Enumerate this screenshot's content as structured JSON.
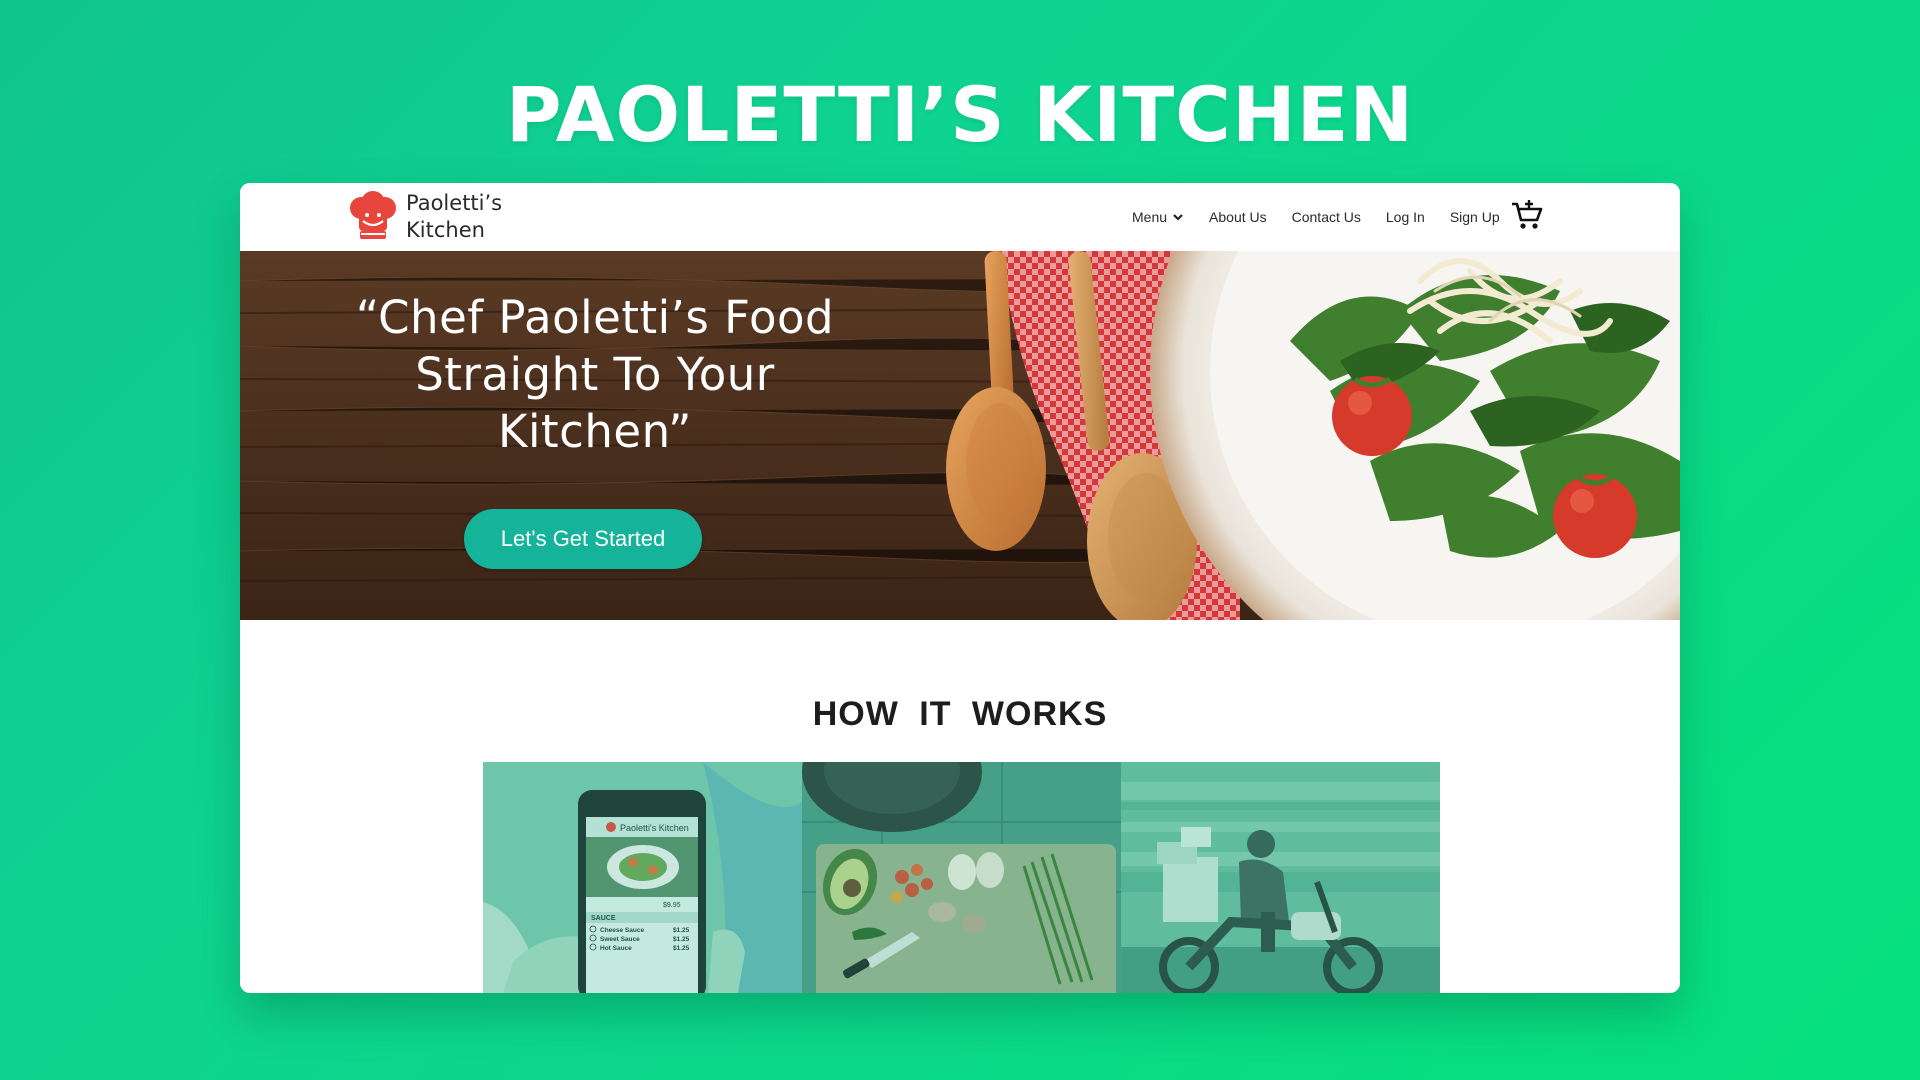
{
  "page": {
    "title": "PAOLETTI’S KITCHEN"
  },
  "header": {
    "brand_line1": "Paoletti’s",
    "brand_line2": "Kitchen",
    "nav": [
      {
        "label": "Menu",
        "has_dropdown": true
      },
      {
        "label": "About Us"
      },
      {
        "label": "Contact Us"
      },
      {
        "label": "Log In"
      },
      {
        "label": "Sign Up"
      }
    ],
    "cart_icon": "cart-plus-icon",
    "logo_icon": "chef-hat-icon"
  },
  "hero": {
    "headline": "“Chef Paoletti’s Food Straight To Your Kitchen”",
    "cta_label": "Let's Get Started"
  },
  "how_it_works": {
    "title": "HOW IT WORKS",
    "phone": {
      "app_name": "Paoletti's Kitchen",
      "price": "$9.95",
      "section": "SAUCE",
      "options": [
        {
          "name": "Cheese Sauce",
          "price": "$1.25"
        },
        {
          "name": "Sweet Sauce",
          "price": "$1.25"
        },
        {
          "name": "Hot Sauce",
          "price": "$1.25"
        }
      ]
    }
  },
  "colors": {
    "background_start": "#10c48c",
    "background_end": "#06e07d",
    "cta": "#14b39a",
    "logo": "#e8453c",
    "panel_tint": "#1fb890"
  }
}
